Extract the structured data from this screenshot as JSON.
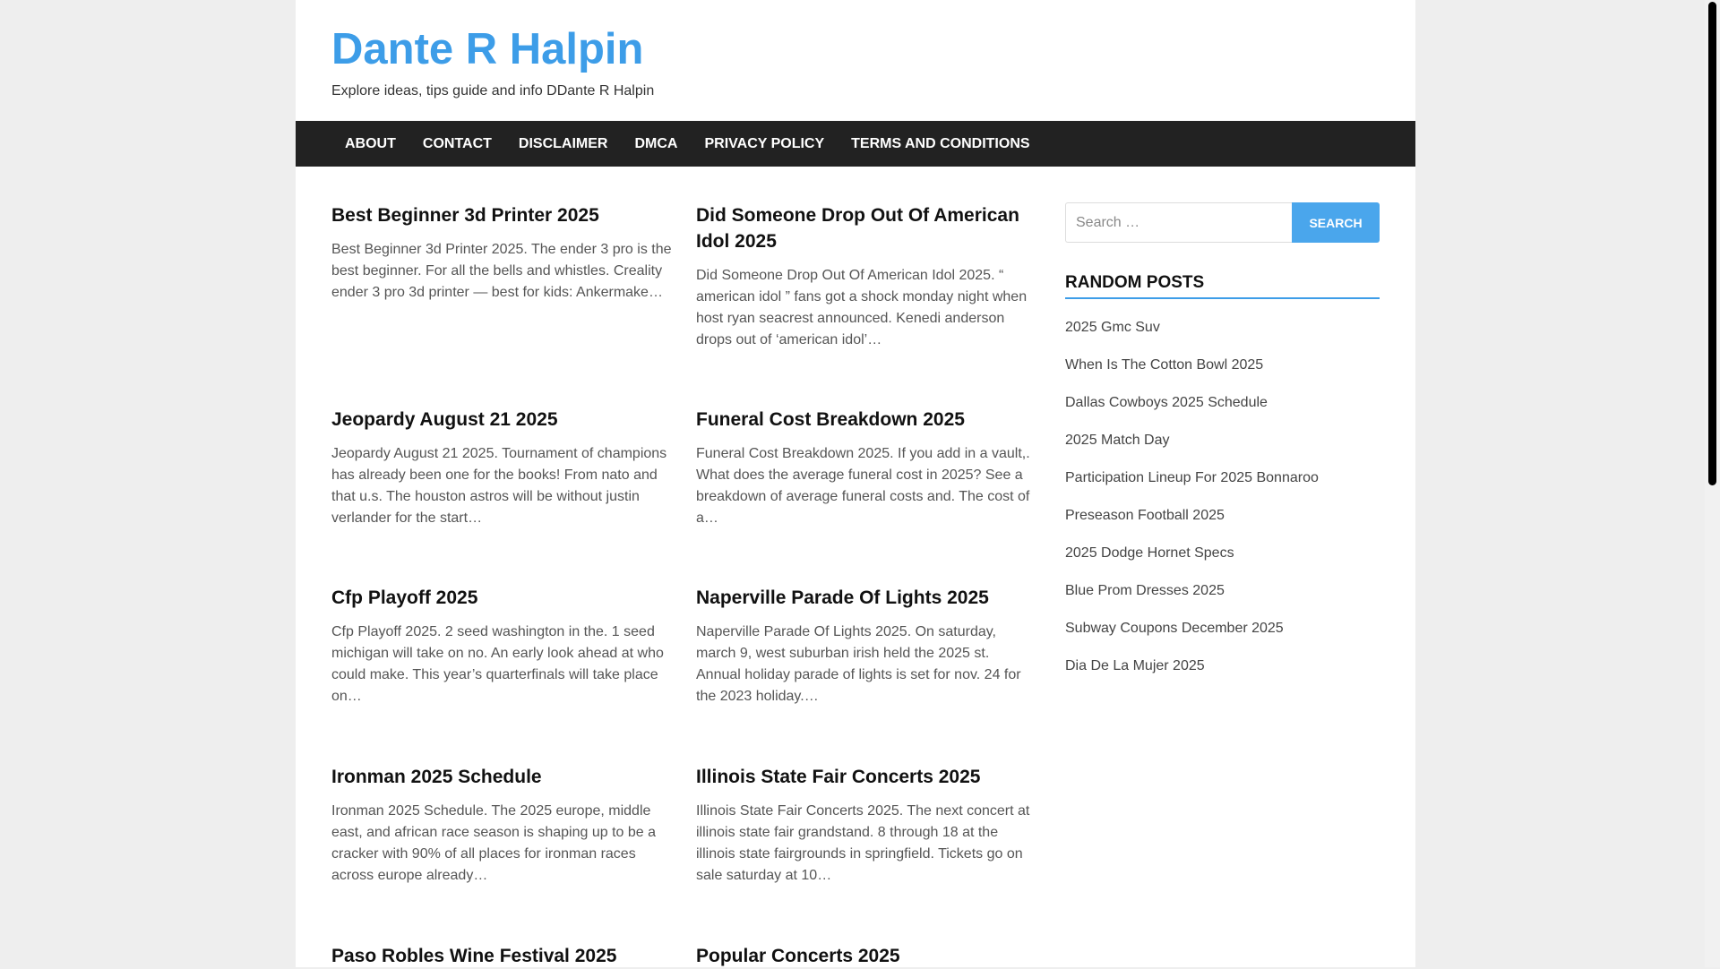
{
  "site": {
    "title": "Dante R Halpin",
    "description": "Explore ideas, tips guide and info DDante R Halpin"
  },
  "nav": {
    "items": [
      "ABOUT",
      "CONTACT",
      "DISCLAIMER",
      "DMCA",
      "PRIVACY POLICY",
      "TERMS AND CONDITIONS"
    ]
  },
  "posts": [
    {
      "title": "Best Beginner 3d Printer 2025",
      "excerpt": "Best Beginner 3d Printer 2025. The ender 3 pro is the best beginner. For all the bells and whistles. Creality ender 3 pro 3d printer — best for kids: Ankermake…"
    },
    {
      "title": "Did Someone Drop Out Of American Idol 2025",
      "excerpt": "Did Someone Drop Out Of American Idol 2025. “ american idol ” fans got a shock monday night when host ryan seacrest announced. Kenedi anderson drops out of ‘american idol’…"
    },
    {
      "title": "Jeopardy August 21 2025",
      "excerpt": "Jeopardy August 21 2025. Tournament of champions has already been one for the books! From nato and that u.s. The houston astros will be without justin verlander for the start…"
    },
    {
      "title": "Funeral Cost Breakdown 2025",
      "excerpt": "Funeral Cost Breakdown 2025. If you add in a vault,. What does the average funeral cost in 2025? See a breakdown of average funeral costs and. The cost of a…"
    },
    {
      "title": "Cfp Playoff 2025",
      "excerpt": "Cfp Playoff 2025. 2 seed washington in the. 1 seed michigan will take on no. An early look ahead at who could make. This year’s quarterfinals will take place on…"
    },
    {
      "title": "Naperville Parade Of Lights 2025",
      "excerpt": "Naperville Parade Of Lights 2025. On saturday, march 9, west suburban irish held the 2025 st. Annual holiday parade of lights is set for nov. 24 for the 2023 holiday.…"
    },
    {
      "title": "Ironman 2025 Schedule",
      "excerpt": "Ironman 2025 Schedule. The 2025 europe, middle east, and african race season is shaping up to be a cracker with 90% of all places for ironman races across europe already…"
    },
    {
      "title": "Illinois State Fair Concerts 2025",
      "excerpt": "Illinois State Fair Concerts 2025. The next concert at illinois state fair grandstand. 8 through 18 at the illinois state fairgrounds in springfield. Tickets go on sale saturday at 10…"
    },
    {
      "title": "Paso Robles Wine Festival 2025",
      "excerpt": ""
    },
    {
      "title": "Popular Concerts 2025",
      "excerpt": ""
    }
  ],
  "search": {
    "placeholder": "Search …",
    "button_label": "Search"
  },
  "random_posts": {
    "heading": "RANDOM POSTS",
    "items": [
      "2025 Gmc Suv",
      "When Is The Cotton Bowl 2025",
      "Dallas Cowboys 2025 Schedule",
      "2025 Match Day",
      "Participation Lineup For 2025 Bonnaroo",
      "Preseason Football 2025",
      "2025 Dodge Hornet Specs",
      "Blue Prom Dresses 2025",
      "Subway Coupons December 2025",
      "Dia De La Mujer 2025"
    ]
  },
  "colors": {
    "accent": "#3d9de8",
    "nav_bg": "#222222",
    "button_bg": "#4aa6ec"
  }
}
